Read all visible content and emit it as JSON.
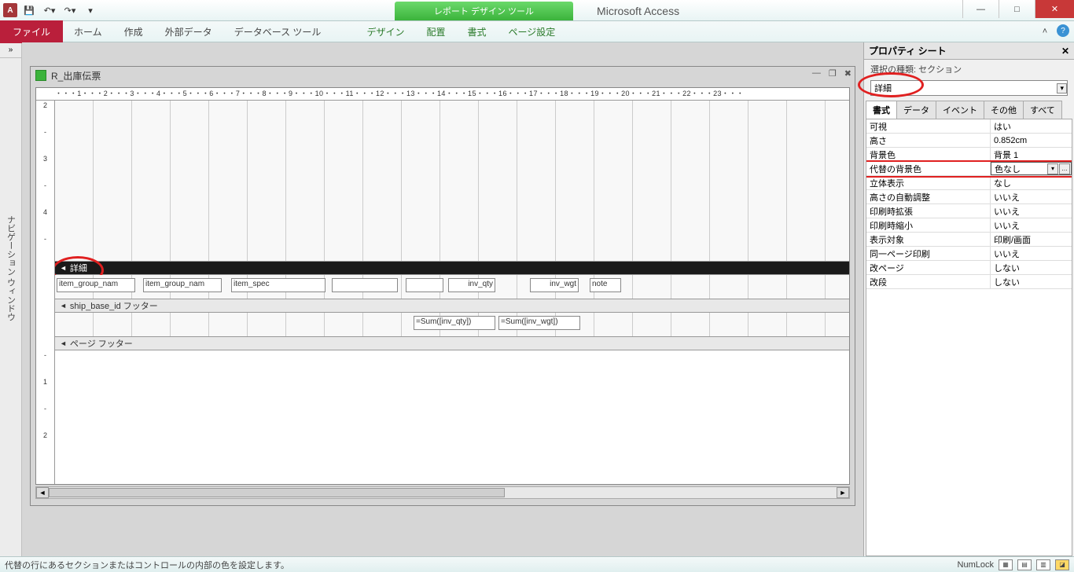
{
  "titlebar": {
    "context_tool": "レポート デザイン ツール",
    "app_name": "Microsoft Access"
  },
  "ribbon": {
    "file": "ファイル",
    "tabs": [
      "ホーム",
      "作成",
      "外部データ",
      "データベース ツール"
    ],
    "ctx_tabs": [
      "デザイン",
      "配置",
      "書式",
      "ページ設定"
    ]
  },
  "nav": {
    "label": "ナビゲーション ウィンドウ"
  },
  "doc": {
    "title": "R_出庫伝票",
    "ruler_h": "・・・1・・・2・・・3・・・4・・・5・・・6・・・7・・・8・・・9・・・10・・・11・・・12・・・13・・・14・・・15・・・16・・・17・・・18・・・19・・・20・・・21・・・22・・・23・・・"
  },
  "sections": {
    "detail": "詳細",
    "group_footer": "ship_base_id フッター",
    "page_footer": "ページ フッター"
  },
  "controls": {
    "c1": "item_group_nam",
    "c2": "item_group_nam",
    "c3": "item_spec",
    "c4": "inv_qty",
    "c5": "inv_wgt",
    "c6": "note",
    "f1": "=Sum([inv_qty])",
    "f2": "=Sum([inv_wgt])"
  },
  "propsheet": {
    "title": "プロパティ シート",
    "type_label": "選択の種類: セクション",
    "selected": "詳細",
    "tabs": [
      "書式",
      "データ",
      "イベント",
      "その他",
      "すべて"
    ],
    "rows": [
      {
        "k": "可視",
        "v": "はい"
      },
      {
        "k": "高さ",
        "v": "0.852cm"
      },
      {
        "k": "背景色",
        "v": "背景 1"
      },
      {
        "k": "代替の背景色",
        "v": "色なし",
        "sel": true
      },
      {
        "k": "立体表示",
        "v": "なし"
      },
      {
        "k": "高さの自動調整",
        "v": "いいえ"
      },
      {
        "k": "印刷時拡張",
        "v": "いいえ"
      },
      {
        "k": "印刷時縮小",
        "v": "いいえ"
      },
      {
        "k": "表示対象",
        "v": "印刷/画面"
      },
      {
        "k": "同一ページ印刷",
        "v": "いいえ"
      },
      {
        "k": "改ページ",
        "v": "しない"
      },
      {
        "k": "改段",
        "v": "しない"
      }
    ]
  },
  "statusbar": {
    "msg": "代替の行にあるセクションまたはコントロールの内部の色を設定します。",
    "numlock": "NumLock"
  }
}
